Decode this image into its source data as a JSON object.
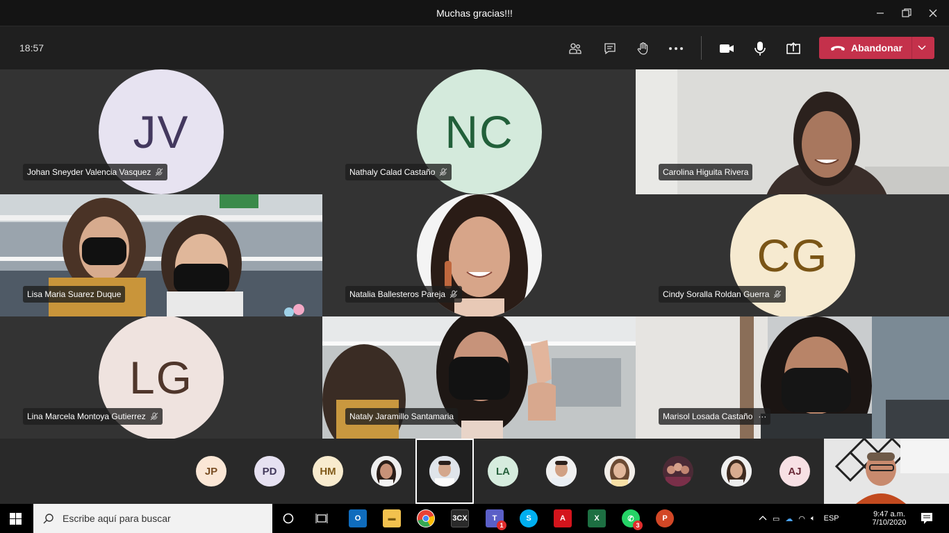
{
  "window": {
    "title": "Muchas gracias!!!"
  },
  "toolbar": {
    "time": "18:57",
    "leave_label": "Abandonar"
  },
  "tiles": [
    {
      "name": "Johan Sneyder Valencia Vasquez",
      "initials": "JV",
      "muted": true,
      "avatar_bg": "#e7e3f1",
      "avatar_fg": "#43385e"
    },
    {
      "name": "Nathaly Calad Castaño",
      "initials": "NC",
      "muted": true,
      "avatar_bg": "#d4eadc",
      "avatar_fg": "#22603a"
    },
    {
      "name": "Carolina Higuita Rivera",
      "video": true
    },
    {
      "name": "Lisa Maria Suarez Duque",
      "video": true
    },
    {
      "name": "Natalia Ballesteros Pareja",
      "muted": true,
      "photo_avatar": true
    },
    {
      "name": "Cindy Soralla Roldan Guerra",
      "initials": "CG",
      "muted": true,
      "avatar_bg": "#f6ead0",
      "avatar_fg": "#7a5516"
    },
    {
      "name": "Lina Marcela Montoya Gutierrez",
      "initials": "LG",
      "muted": true,
      "avatar_bg": "#efe3df",
      "avatar_fg": "#4f362b"
    },
    {
      "name": "Nataly Jaramillo Santamaria",
      "video": true
    },
    {
      "name": "Marisol Losada Castaño",
      "video": true,
      "more": "···"
    }
  ],
  "strip": [
    {
      "initials": "JP",
      "bg": "#fbe7d6",
      "fg": "#7a4e24"
    },
    {
      "initials": "PD",
      "bg": "#e6e1f1",
      "fg": "#433a5c"
    },
    {
      "initials": "HM",
      "bg": "#f8ebce",
      "fg": "#805a19"
    },
    {
      "initials": "",
      "photo": true
    },
    {
      "initials": "",
      "photo": true,
      "selected": true
    },
    {
      "initials": "LA",
      "bg": "#d6ecde",
      "fg": "#255f3b"
    },
    {
      "initials": "",
      "photo": true
    },
    {
      "initials": "",
      "photo": true
    },
    {
      "initials": "",
      "photo": true
    },
    {
      "initials": "",
      "photo": true
    },
    {
      "initials": "AJ",
      "bg": "#f7e0e4",
      "fg": "#6b2b38"
    }
  ],
  "taskbar": {
    "search_placeholder": "Escribe aquí para buscar",
    "apps": [
      "Outlook",
      "File Explorer",
      "Chrome",
      "3CX",
      "Teams",
      "Skype",
      "Acrobat",
      "Excel",
      "WhatsApp",
      "PowerPoint"
    ],
    "badges": {
      "teams": "1",
      "whatsapp": "3"
    },
    "language": "ESP",
    "time": "9:47 a.m.",
    "date": "7/10/2020",
    "colors": {
      "outlook": "#0f6cbd",
      "explorer": "#f2c14e",
      "chrome": "#e94235",
      "threecx": "#2a2a2a",
      "teams": "#5b5fc7",
      "skype": "#00aff0",
      "acrobat": "#d4141c",
      "excel": "#1d6f42",
      "whatsapp": "#25d366",
      "powerpoint": "#d24726"
    }
  }
}
